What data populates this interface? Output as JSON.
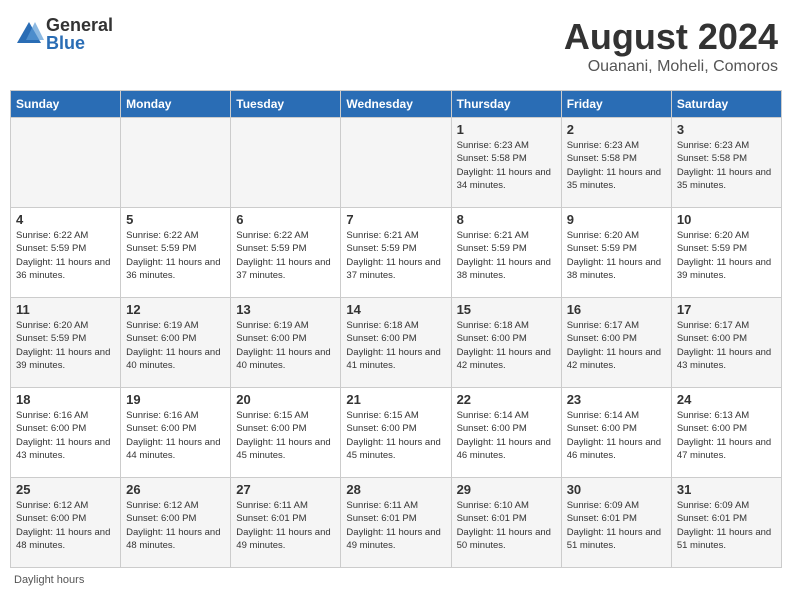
{
  "header": {
    "logo_general": "General",
    "logo_blue": "Blue",
    "month_year": "August 2024",
    "location": "Ouanani, Moheli, Comoros"
  },
  "days_of_week": [
    "Sunday",
    "Monday",
    "Tuesday",
    "Wednesday",
    "Thursday",
    "Friday",
    "Saturday"
  ],
  "weeks": [
    [
      {
        "day": "",
        "info": ""
      },
      {
        "day": "",
        "info": ""
      },
      {
        "day": "",
        "info": ""
      },
      {
        "day": "",
        "info": ""
      },
      {
        "day": "1",
        "info": "Sunrise: 6:23 AM\nSunset: 5:58 PM\nDaylight: 11 hours and 34 minutes."
      },
      {
        "day": "2",
        "info": "Sunrise: 6:23 AM\nSunset: 5:58 PM\nDaylight: 11 hours and 35 minutes."
      },
      {
        "day": "3",
        "info": "Sunrise: 6:23 AM\nSunset: 5:58 PM\nDaylight: 11 hours and 35 minutes."
      }
    ],
    [
      {
        "day": "4",
        "info": "Sunrise: 6:22 AM\nSunset: 5:59 PM\nDaylight: 11 hours and 36 minutes."
      },
      {
        "day": "5",
        "info": "Sunrise: 6:22 AM\nSunset: 5:59 PM\nDaylight: 11 hours and 36 minutes."
      },
      {
        "day": "6",
        "info": "Sunrise: 6:22 AM\nSunset: 5:59 PM\nDaylight: 11 hours and 37 minutes."
      },
      {
        "day": "7",
        "info": "Sunrise: 6:21 AM\nSunset: 5:59 PM\nDaylight: 11 hours and 37 minutes."
      },
      {
        "day": "8",
        "info": "Sunrise: 6:21 AM\nSunset: 5:59 PM\nDaylight: 11 hours and 38 minutes."
      },
      {
        "day": "9",
        "info": "Sunrise: 6:20 AM\nSunset: 5:59 PM\nDaylight: 11 hours and 38 minutes."
      },
      {
        "day": "10",
        "info": "Sunrise: 6:20 AM\nSunset: 5:59 PM\nDaylight: 11 hours and 39 minutes."
      }
    ],
    [
      {
        "day": "11",
        "info": "Sunrise: 6:20 AM\nSunset: 5:59 PM\nDaylight: 11 hours and 39 minutes."
      },
      {
        "day": "12",
        "info": "Sunrise: 6:19 AM\nSunset: 6:00 PM\nDaylight: 11 hours and 40 minutes."
      },
      {
        "day": "13",
        "info": "Sunrise: 6:19 AM\nSunset: 6:00 PM\nDaylight: 11 hours and 40 minutes."
      },
      {
        "day": "14",
        "info": "Sunrise: 6:18 AM\nSunset: 6:00 PM\nDaylight: 11 hours and 41 minutes."
      },
      {
        "day": "15",
        "info": "Sunrise: 6:18 AM\nSunset: 6:00 PM\nDaylight: 11 hours and 42 minutes."
      },
      {
        "day": "16",
        "info": "Sunrise: 6:17 AM\nSunset: 6:00 PM\nDaylight: 11 hours and 42 minutes."
      },
      {
        "day": "17",
        "info": "Sunrise: 6:17 AM\nSunset: 6:00 PM\nDaylight: 11 hours and 43 minutes."
      }
    ],
    [
      {
        "day": "18",
        "info": "Sunrise: 6:16 AM\nSunset: 6:00 PM\nDaylight: 11 hours and 43 minutes."
      },
      {
        "day": "19",
        "info": "Sunrise: 6:16 AM\nSunset: 6:00 PM\nDaylight: 11 hours and 44 minutes."
      },
      {
        "day": "20",
        "info": "Sunrise: 6:15 AM\nSunset: 6:00 PM\nDaylight: 11 hours and 45 minutes."
      },
      {
        "day": "21",
        "info": "Sunrise: 6:15 AM\nSunset: 6:00 PM\nDaylight: 11 hours and 45 minutes."
      },
      {
        "day": "22",
        "info": "Sunrise: 6:14 AM\nSunset: 6:00 PM\nDaylight: 11 hours and 46 minutes."
      },
      {
        "day": "23",
        "info": "Sunrise: 6:14 AM\nSunset: 6:00 PM\nDaylight: 11 hours and 46 minutes."
      },
      {
        "day": "24",
        "info": "Sunrise: 6:13 AM\nSunset: 6:00 PM\nDaylight: 11 hours and 47 minutes."
      }
    ],
    [
      {
        "day": "25",
        "info": "Sunrise: 6:12 AM\nSunset: 6:00 PM\nDaylight: 11 hours and 48 minutes."
      },
      {
        "day": "26",
        "info": "Sunrise: 6:12 AM\nSunset: 6:00 PM\nDaylight: 11 hours and 48 minutes."
      },
      {
        "day": "27",
        "info": "Sunrise: 6:11 AM\nSunset: 6:01 PM\nDaylight: 11 hours and 49 minutes."
      },
      {
        "day": "28",
        "info": "Sunrise: 6:11 AM\nSunset: 6:01 PM\nDaylight: 11 hours and 49 minutes."
      },
      {
        "day": "29",
        "info": "Sunrise: 6:10 AM\nSunset: 6:01 PM\nDaylight: 11 hours and 50 minutes."
      },
      {
        "day": "30",
        "info": "Sunrise: 6:09 AM\nSunset: 6:01 PM\nDaylight: 11 hours and 51 minutes."
      },
      {
        "day": "31",
        "info": "Sunrise: 6:09 AM\nSunset: 6:01 PM\nDaylight: 11 hours and 51 minutes."
      }
    ]
  ],
  "footer": {
    "note": "Daylight hours"
  }
}
